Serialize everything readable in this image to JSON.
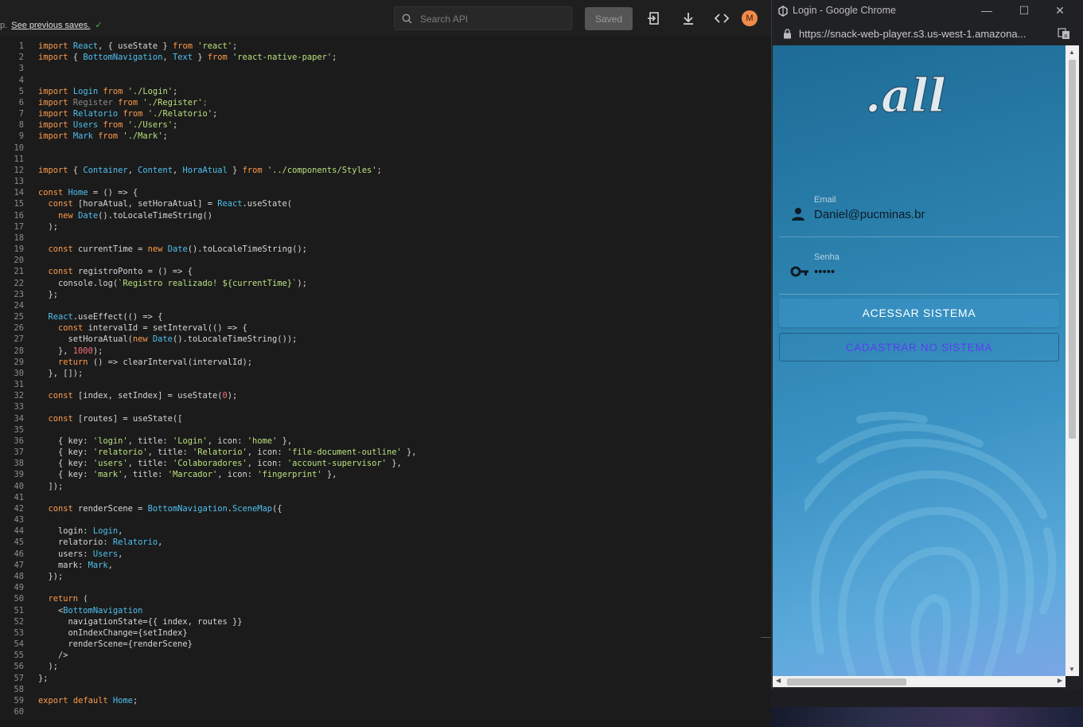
{
  "editor": {
    "save_note_prefix": "p.",
    "save_note_link": "See previous saves.",
    "search_placeholder": "Search API",
    "saved_label": "Saved",
    "avatar_initial": "M",
    "lines": [
      "import React, { useState } from 'react';",
      "import { BottomNavigation, Text } from 'react-native-paper';",
      "",
      "",
      "import Login from './Login';",
      "import Register from './Register';",
      "import Relatorio from './Relatorio';",
      "import Users from './Users';",
      "import Mark from './Mark';",
      "",
      "",
      "import { Container, Content, HoraAtual } from '../components/Styles';",
      "",
      "const Home = () => {",
      "  const [horaAtual, setHoraAtual] = React.useState(",
      "    new Date().toLocaleTimeString()",
      "  );",
      "",
      "  const currentTime = new Date().toLocaleTimeString();",
      "",
      "  const registroPonto = () => {",
      "    console.log(`Registro realizado! ${currentTime}`);",
      "  };",
      "",
      "  React.useEffect(() => {",
      "    const intervalId = setInterval(() => {",
      "      setHoraAtual(new Date().toLocaleTimeString());",
      "    }, 1000);",
      "    return () => clearInterval(intervalId);",
      "  }, []);",
      "",
      "  const [index, setIndex] = useState(0);",
      "",
      "  const [routes] = useState([",
      "",
      "    { key: 'login', title: 'Login', icon: 'home' },",
      "    { key: 'relatorio', title: 'Relatorio', icon: 'file-document-outline' },",
      "    { key: 'users', title: 'Colaboradores', icon: 'account-supervisor' },",
      "    { key: 'mark', title: 'Marcador', icon: 'fingerprint' },",
      "  ]);",
      "",
      "  const renderScene = BottomNavigation.SceneMap({",
      "",
      "    login: Login,",
      "    relatorio: Relatorio,",
      "    users: Users,",
      "    mark: Mark,",
      "  });",
      "",
      "  return (",
      "    <BottomNavigation",
      "      navigationState={{ index, routes }}",
      "      onIndexChange={setIndex}",
      "      renderScene={renderScene}",
      "    />",
      "  );",
      "};",
      "",
      "export default Home;",
      ""
    ]
  },
  "browser": {
    "window_title": "Login - Google Chrome",
    "url": "https://snack-web-player.s3.us-west-1.amazona...",
    "minimize_label": "—",
    "maximize_label": "☐",
    "close_label": "✕"
  },
  "app": {
    "logo_text": ".all",
    "email_label": "Email",
    "email_value": "Daniel@pucminas.br",
    "password_label": "Senha",
    "password_value": "•••••",
    "access_button": "ACESSAR SISTEMA",
    "register_button": "CADASTRAR NO SISTEMA"
  },
  "colors": {
    "keyword": "#ff9c4a",
    "string": "#b9e07e",
    "identifier": "#4ec0f0",
    "register_text": "#5a3df0",
    "avatar": "#f08a4b"
  },
  "icons": [
    "search-icon",
    "export-icon",
    "download-icon",
    "code-icon",
    "user-icon",
    "key-icon",
    "fingerprint-icon",
    "lock-icon",
    "translate-icon"
  ]
}
